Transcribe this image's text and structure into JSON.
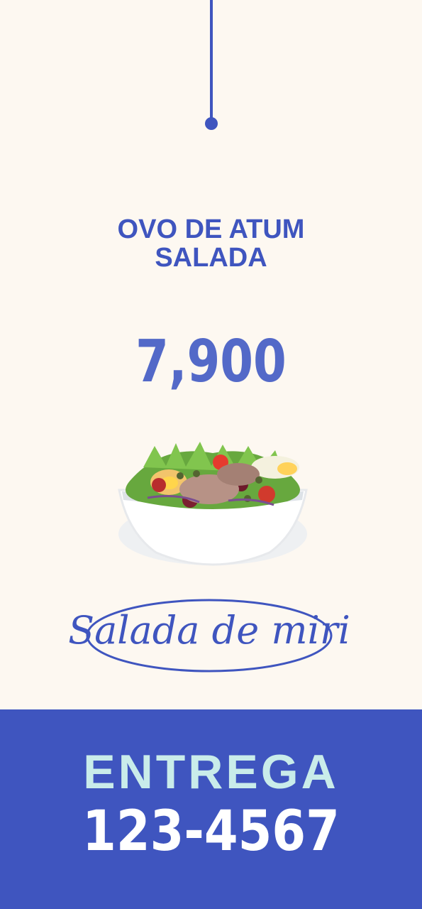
{
  "menu": {
    "title_lines": [
      "OVO DE ATUM",
      "SALADA"
    ],
    "price": "7,900",
    "brand": "Salada de miri"
  },
  "footer": {
    "delivery_label": "ENTREGA",
    "phone": "123-4567"
  },
  "colors": {
    "accent": "#3f55bf",
    "price": "#5369c8",
    "background": "#fdf8f1",
    "delivery_text": "#c9ecea",
    "phone_text": "#ffffff"
  },
  "icons": {
    "salad_image": "salad-bowl-icon"
  }
}
